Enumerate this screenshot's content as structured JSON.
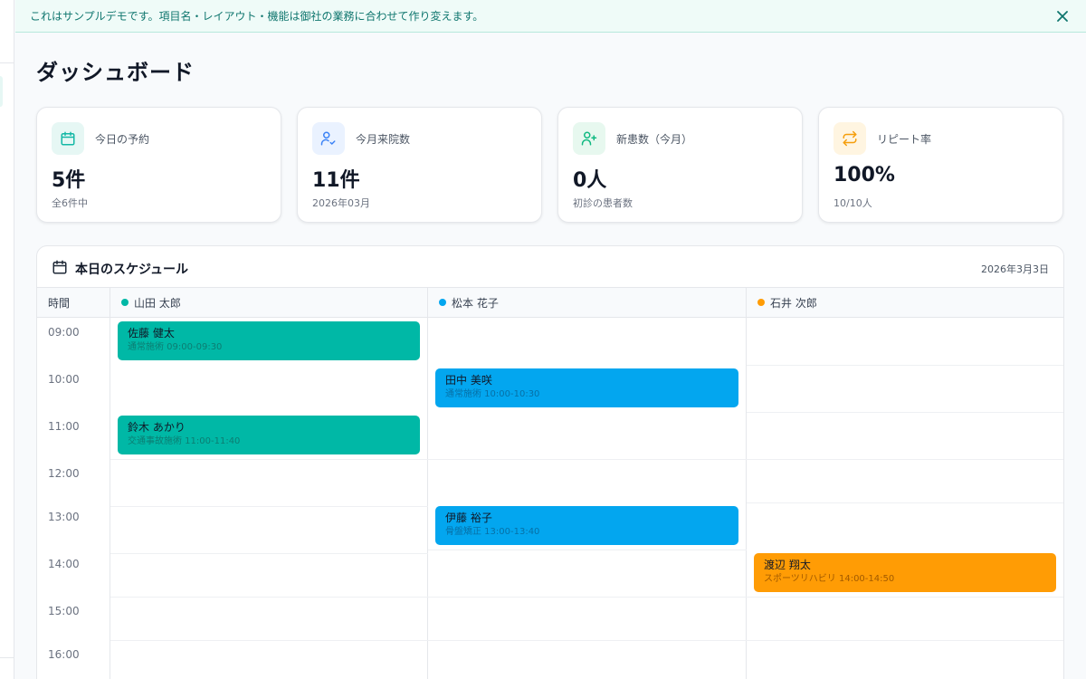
{
  "banner": {
    "text": "これはサンプルデモです。項目名・レイアウト・機能は御社の業務に合わせて作り変えます。",
    "close_icon": "x-icon"
  },
  "page": {
    "title": "ダッシュボード"
  },
  "stats": [
    {
      "label": "今日の予約",
      "value": "5件",
      "sub": "全6件中",
      "icon": "calendar-icon",
      "icon_color": "#14b8a6",
      "icon_bg": "#e6f7f4"
    },
    {
      "label": "今月来院数",
      "value": "11件",
      "sub": "2026年03月",
      "icon": "user-check-icon",
      "icon_color": "#3b82f6",
      "icon_bg": "#eaf2ff"
    },
    {
      "label": "新患数（今月）",
      "value": "0人",
      "sub": "初診の患者数",
      "icon": "user-plus-icon",
      "icon_color": "#10b981",
      "icon_bg": "#e7f8ef"
    },
    {
      "label": "リピート率",
      "value": "100%",
      "sub": "10/10人",
      "icon": "repeat-icon",
      "icon_color": "#f59e0b",
      "icon_bg": "#fff5e1"
    }
  ],
  "schedule": {
    "title": "本日のスケジュール",
    "date": "2026年3月3日",
    "time_header": "時間",
    "times": [
      "09:00",
      "10:00",
      "11:00",
      "12:00",
      "13:00",
      "14:00",
      "15:00",
      "16:00"
    ],
    "staff": [
      {
        "name": "山田 太郎",
        "color": "#00b8a6"
      },
      {
        "name": "松本 花子",
        "color": "#03a6ef"
      },
      {
        "name": "石井 次郎",
        "color": "#ff9c05"
      }
    ],
    "appointments": [
      {
        "staff_index": 0,
        "name": "佐藤 健太",
        "detail": "通常施術 09:00-09:30"
      },
      {
        "staff_index": 1,
        "name": "田中 美咲",
        "detail": "通常施術 10:00-10:30"
      },
      {
        "staff_index": 0,
        "name": "鈴木 あかり",
        "detail": "交通事故施術 11:00-11:40"
      },
      {
        "staff_index": 1,
        "name": "伊藤 裕子",
        "detail": "骨盤矯正 13:00-13:40"
      },
      {
        "staff_index": 2,
        "name": "渡辺 翔太",
        "detail": "スポーツリハビリ 14:00-14:50"
      }
    ]
  }
}
